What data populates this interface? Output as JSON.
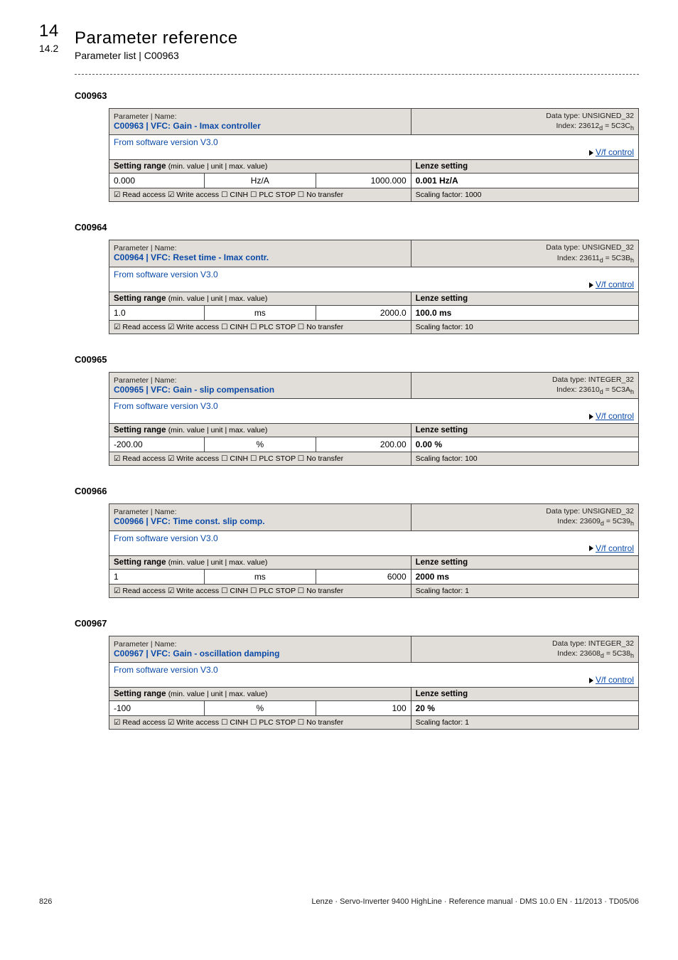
{
  "header": {
    "chapter_num": "14",
    "chapter_title": "Parameter reference",
    "section_num": "14.2",
    "section_title": "Parameter list | C00963"
  },
  "common": {
    "param_label": "Parameter | Name:",
    "sw_version": "From software version V3.0",
    "vf_link": "V/f control",
    "setting_range_label": "Setting range",
    "setting_range_sub": "(min. value | unit | max. value)",
    "lenze_label": "Lenze setting",
    "access_flags": "☑ Read access  ☑ Write access  ☐ CINH  ☐ PLC STOP  ☐ No transfer"
  },
  "blocks": [
    {
      "code": "C00963",
      "name": "C00963 | VFC: Gain - Imax controller",
      "datatype": "Data type: UNSIGNED_32",
      "index": "Index: 23612d = 5C3Ch",
      "min": "0.000",
      "unit": "Hz/A",
      "max": "1000.000",
      "lenze": "0.001 Hz/A",
      "scaling": "Scaling factor: 1000"
    },
    {
      "code": "C00964",
      "name": "C00964 | VFC: Reset time - Imax contr.",
      "datatype": "Data type: UNSIGNED_32",
      "index": "Index: 23611d = 5C3Bh",
      "min": "1.0",
      "unit": "ms",
      "max": "2000.0",
      "lenze": "100.0 ms",
      "scaling": "Scaling factor: 10"
    },
    {
      "code": "C00965",
      "name": "C00965 | VFC: Gain - slip compensation",
      "datatype": "Data type: INTEGER_32",
      "index": "Index: 23610d = 5C3Ah",
      "min": "-200.00",
      "unit": "%",
      "max": "200.00",
      "lenze": "0.00 %",
      "scaling": "Scaling factor: 100"
    },
    {
      "code": "C00966",
      "name": "C00966 | VFC: Time const. slip comp.",
      "datatype": "Data type: UNSIGNED_32",
      "index": "Index: 23609d = 5C39h",
      "min": "1",
      "unit": "ms",
      "max": "6000",
      "lenze": "2000 ms",
      "scaling": "Scaling factor: 1"
    },
    {
      "code": "C00967",
      "name": "C00967 | VFC: Gain - oscillation damping",
      "datatype": "Data type: INTEGER_32",
      "index": "Index: 23608d = 5C38h",
      "min": "-100",
      "unit": "%",
      "max": "100",
      "lenze": "20 %",
      "scaling": "Scaling factor: 1"
    }
  ],
  "footer": {
    "page": "826",
    "text": "Lenze · Servo-Inverter 9400 HighLine · Reference manual · DMS 10.0 EN · 11/2013 · TD05/06"
  }
}
